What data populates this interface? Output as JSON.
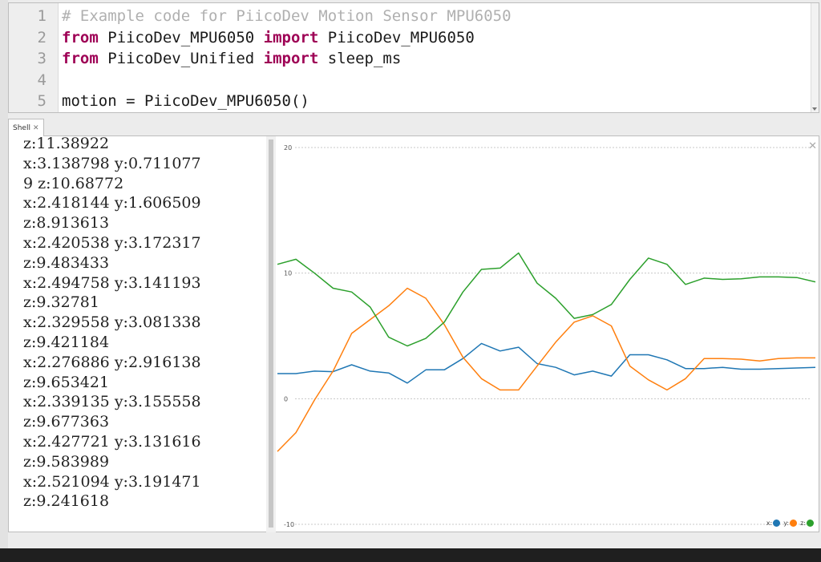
{
  "editor": {
    "lines": [
      {
        "num": "1",
        "parts": [
          {
            "t": "# Example code for PiicoDev Motion Sensor MPU6050",
            "k": "cm"
          }
        ]
      },
      {
        "num": "2",
        "parts": [
          {
            "t": "from",
            "k": "kw"
          },
          {
            "t": " PiicoDev_MPU6050 ",
            "k": ""
          },
          {
            "t": "import",
            "k": "kw"
          },
          {
            "t": " PiicoDev_MPU6050",
            "k": ""
          }
        ]
      },
      {
        "num": "3",
        "parts": [
          {
            "t": "from",
            "k": "kw"
          },
          {
            "t": " PiicoDev_Unified ",
            "k": ""
          },
          {
            "t": "import",
            "k": "kw"
          },
          {
            "t": " sleep_ms",
            "k": ""
          }
        ]
      },
      {
        "num": "4",
        "parts": []
      },
      {
        "num": "5",
        "parts": [
          {
            "t": "motion = PiicoDev_MPU6050()",
            "k": ""
          }
        ]
      }
    ]
  },
  "shell": {
    "tab_label": "Shell",
    "close_glyph": "✕",
    "lines": [
      "z:11.38922",
      "x:3.138798 y:0.711077",
      "9 z:10.68772",
      "x:2.418144 y:1.606509",
      "z:8.913613",
      "x:2.420538 y:3.172317",
      "z:9.483433",
      "x:2.494758 y:3.141193",
      "z:9.32781",
      "x:2.329558 y:3.081338",
      "z:9.421184",
      "x:2.276886 y:2.916138",
      "z:9.653421",
      "x:2.339135 y:3.155558",
      "z:9.677363",
      "x:2.427721 y:3.131616",
      "z:9.583989",
      "x:2.521094 y:3.191471",
      "z:9.241618"
    ]
  },
  "plotter": {
    "close_glyph": "✕",
    "legend": [
      {
        "label": "x:",
        "color": "#1f77b4"
      },
      {
        "label": "y:",
        "color": "#ff7f0e"
      },
      {
        "label": "z:",
        "color": "#2ca02c"
      }
    ]
  },
  "chart_data": {
    "type": "line",
    "ylim": [
      -10,
      20
    ],
    "yticks": [
      "20",
      "10",
      "0",
      "-10"
    ],
    "grid": true,
    "legend_position": "bottom-right",
    "series": [
      {
        "name": "x",
        "color": "#1f77b4",
        "values": [
          2.0,
          2.0,
          2.2,
          2.15,
          2.7,
          2.2,
          2.05,
          1.25,
          2.3,
          2.3,
          3.2,
          4.4,
          3.8,
          4.1,
          2.8,
          2.5,
          1.9,
          2.2,
          1.8,
          3.5,
          3.5,
          3.1,
          2.4,
          2.4,
          2.5,
          2.35,
          2.35,
          2.4,
          2.45,
          2.5
        ]
      },
      {
        "name": "y",
        "color": "#ff7f0e",
        "values": [
          -4.2,
          -2.7,
          -0.1,
          2.2,
          5.2,
          6.3,
          7.4,
          8.8,
          8.0,
          5.9,
          3.3,
          1.6,
          0.7,
          0.7,
          2.6,
          4.5,
          6.1,
          6.6,
          5.8,
          2.6,
          1.5,
          0.7,
          1.6,
          3.2,
          3.2,
          3.15,
          3.0,
          3.2,
          3.25,
          3.25
        ]
      },
      {
        "name": "z",
        "color": "#2ca02c",
        "values": [
          10.7,
          11.1,
          10.0,
          8.8,
          8.5,
          7.3,
          4.9,
          4.2,
          4.8,
          6.1,
          8.5,
          10.3,
          10.4,
          11.6,
          9.2,
          8.0,
          6.4,
          6.7,
          7.5,
          9.5,
          11.2,
          10.7,
          9.1,
          9.6,
          9.5,
          9.55,
          9.7,
          9.7,
          9.65,
          9.3
        ]
      }
    ]
  }
}
